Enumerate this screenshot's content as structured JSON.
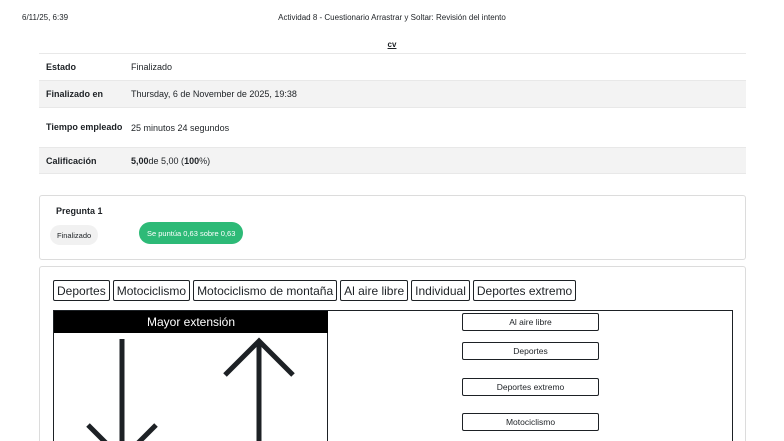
{
  "print_header": {
    "date": "6/11/25, 6:39",
    "title": "Actividad 8 - Cuestionario Arrastrar y Soltar: Revisión del intento"
  },
  "top_link": "cv",
  "summary": {
    "rows": [
      {
        "label": "Estado",
        "value": "Finalizado"
      },
      {
        "label": "Finalizado en",
        "value": "Thursday, 6 de November de 2025, 19:38"
      },
      {
        "label": "Tiempo empleado",
        "value": "25 minutos 24 segundos"
      },
      {
        "label": "Calificación",
        "value_bold1": "5,00",
        "value_mid": " de 5,00 (",
        "value_bold2": "100",
        "value_end": "%)"
      }
    ]
  },
  "question": {
    "title": "Pregunta 1",
    "state": "Finalizado",
    "grade": "Se puntúa 0,63 sobre 0,63",
    "grade_color": "#2dba77"
  },
  "drag_items": [
    "Deportes",
    "Motociclismo",
    "Motociclismo de montaña",
    "Al aire libre",
    "Individual",
    "Deportes extremo"
  ],
  "panel_title": "Mayor extensión",
  "drop_zones": [
    "Al aire libre",
    "Deportes",
    "Deportes extremo",
    "Motociclismo"
  ]
}
